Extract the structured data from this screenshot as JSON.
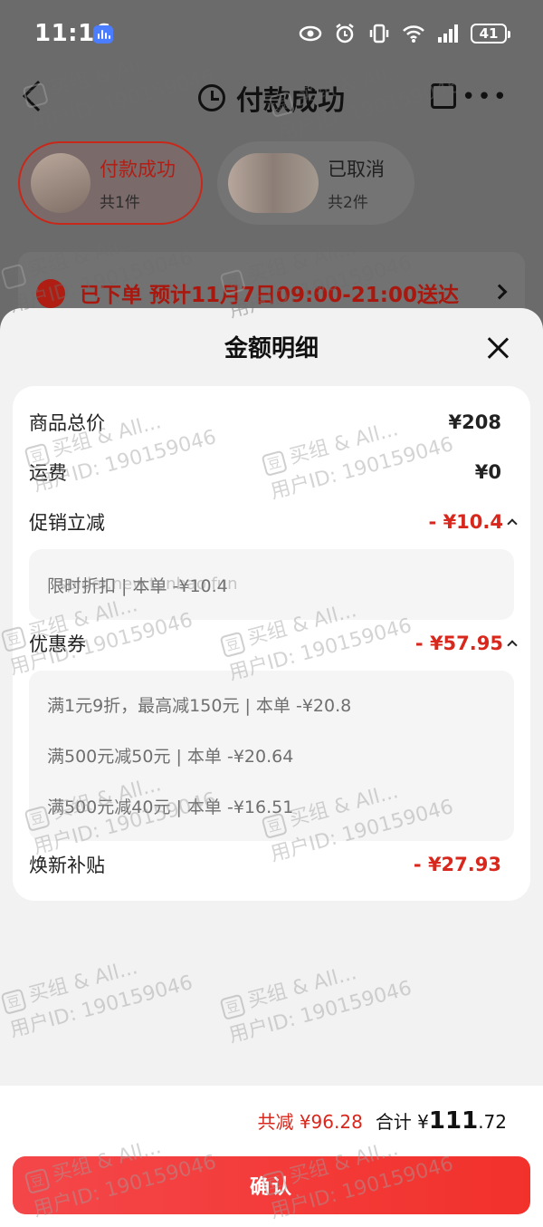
{
  "status_bar": {
    "time": "11:16",
    "battery": "41"
  },
  "header": {
    "title": "付款成功"
  },
  "order_tabs": [
    {
      "title": "付款成功",
      "count": "共1件"
    },
    {
      "title": "已取消",
      "count": "共2件"
    }
  ],
  "notice": {
    "text": "已下单 预计11月7日09:00-21:00送达"
  },
  "sheet": {
    "title": "金额明细",
    "rows": {
      "goods_total": {
        "label": "商品总价",
        "value": "¥208"
      },
      "shipping": {
        "label": "运费",
        "value": "¥0"
      },
      "promotion": {
        "label": "促销立减",
        "value": "- ¥10.4"
      },
      "coupon": {
        "label": "优惠券",
        "value": "- ¥57.95"
      },
      "subsidy": {
        "label": "焕新补贴",
        "value": "- ¥27.93"
      }
    },
    "promotion_details": [
      "限时折扣 | 本单 -¥10.4"
    ],
    "coupon_details": [
      "满1元9折，最高减150元 | 本单 -¥20.8",
      "满500元减50元 | 本单 -¥20.64",
      "满500元减40元 | 本单 -¥16.51"
    ]
  },
  "footer": {
    "total_reduce": "共减 ¥96.28",
    "total_label": "合计 ¥",
    "total_int": "111",
    "total_dec": ".72",
    "confirm": "确认"
  },
  "watermark": {
    "line1": "买组 & All...",
    "line2": "用户ID: 190159046",
    "logo": "豆",
    "url": "spider.new.tanbao.fun"
  }
}
